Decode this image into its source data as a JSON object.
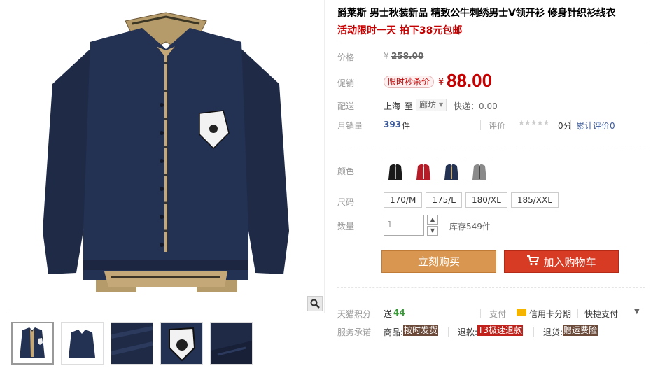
{
  "gallery": {
    "thumbnails": [
      "thumb-front",
      "thumb-sweater-only",
      "thumb-fabric-closeup",
      "thumb-badge-closeup",
      "thumb-cuff-closeup"
    ],
    "active_index": 0
  },
  "product": {
    "title": "爵莱斯 男士秋装新品 精致公牛刺绣男士V领开衫 修身针织衫线衣",
    "promo": "活动限时一天 拍下38元包邮"
  },
  "price": {
    "label": "价格",
    "currency": "¥",
    "original": "258.00"
  },
  "sale": {
    "label": "促销",
    "tag": "限时秒杀价",
    "currency": "¥",
    "price": "88.00"
  },
  "shipping": {
    "label": "配送",
    "from": "上海",
    "to_word": "至",
    "destination": "廊坊",
    "fee": "快递：0.00"
  },
  "sales": {
    "label": "月销量",
    "count": "393",
    "unit": "件",
    "review_label": "评价",
    "stars": "★★★★★",
    "score": "0分",
    "review_link": "累计评价0"
  },
  "color": {
    "label": "颜色",
    "options": [
      "black",
      "red",
      "navy",
      "grey"
    ]
  },
  "size": {
    "label": "尺码",
    "options": [
      "170/M",
      "175/L",
      "180/XL",
      "185/XXL"
    ]
  },
  "quantity": {
    "label": "数量",
    "value": "1",
    "stock": "库存549件"
  },
  "buttons": {
    "buy_now": "立刻购买",
    "add_to_cart": "加入购物车"
  },
  "points": {
    "label": "天猫积分",
    "give": "送",
    "amount": "44"
  },
  "payment": {
    "label": "支付",
    "card": "信用卡分期",
    "quick": "快捷支付"
  },
  "service": {
    "label": "服务承诺",
    "goods_k": "商品:",
    "goods_v": "按时发货",
    "refund_k": "退款:",
    "refund_v": "T3极速退款",
    "return_k": "退货:",
    "return_v": "赠运费险"
  },
  "colors": {
    "accent_red": "#c40000",
    "buy_orange": "#d89650",
    "cart_red": "#d83b24",
    "link_blue": "#3d5a9a",
    "points_green": "#3a9a3a"
  }
}
